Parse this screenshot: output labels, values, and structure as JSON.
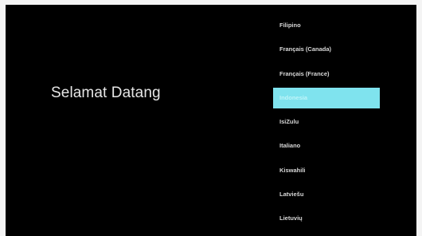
{
  "welcome": {
    "title": "Selamat Datang"
  },
  "languages": {
    "selected_index": 3,
    "selected_color": "#7fe3ee",
    "items": [
      {
        "label": "Filipino"
      },
      {
        "label": "Français (Canada)"
      },
      {
        "label": "Français (France)"
      },
      {
        "label": "Indonesia"
      },
      {
        "label": "IsiZulu"
      },
      {
        "label": "Italiano"
      },
      {
        "label": "Kiswahili"
      },
      {
        "label": "Latviešu"
      },
      {
        "label": "Lietuvių"
      }
    ]
  }
}
